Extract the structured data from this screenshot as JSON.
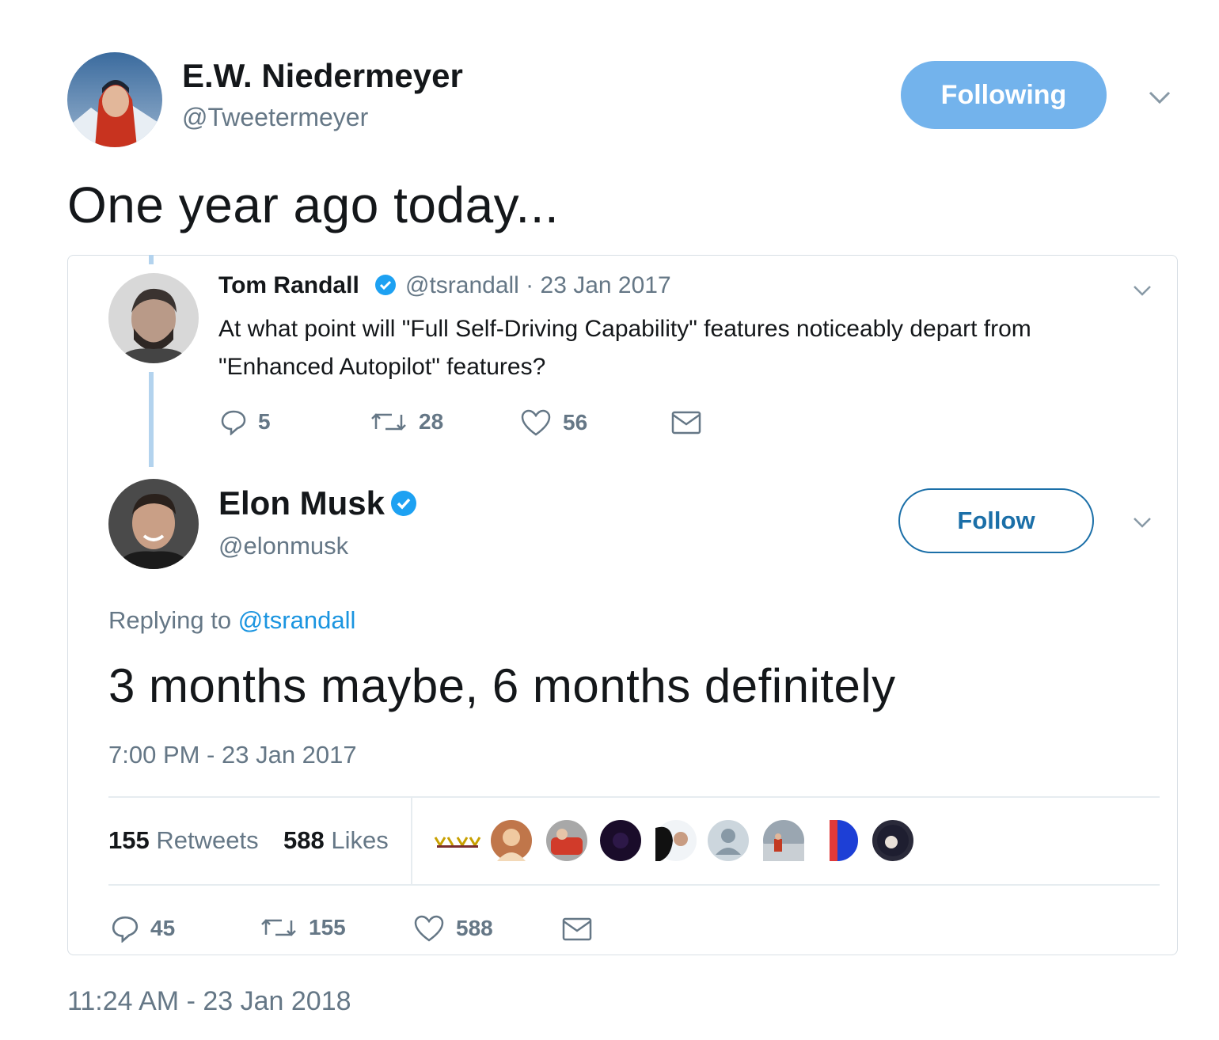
{
  "outer_tweet": {
    "author_name": "E.W. Niedermeyer",
    "author_handle": "@Tweetermeyer",
    "following_label": "Following",
    "text": "One year ago today...",
    "timestamp": "11:24 AM - 23 Jan 2018"
  },
  "quoted_thread": {
    "parent": {
      "author_name": "Tom Randall",
      "author_handle": "@tsrandall · 23 Jan 2017",
      "text": "At what point will \"Full Self-Driving Capability\" features noticeably depart from \"Enhanced Autopilot\" features?",
      "replies": "5",
      "retweets": "28",
      "likes": "56"
    },
    "reply": {
      "author_name": "Elon Musk",
      "author_handle": "@elonmusk",
      "follow_label": "Follow",
      "replying_prefix": "Replying to",
      "replying_handle": "@tsrandall",
      "text": "3 months maybe, 6 months definitely",
      "timestamp": "7:00 PM - 23 Jan 2017",
      "retweets_count": "155",
      "retweets_label": "Retweets",
      "likes_count": "588",
      "likes_label": "Likes",
      "replies": "45",
      "retweets": "155",
      "likes": "588"
    }
  },
  "colors": {
    "following_button": "#73b3ec",
    "follow_border": "#1b6fa8",
    "mention": "#1b95e0",
    "verified": "#1da1f2",
    "muted_text": "#657786",
    "thread_line": "#b3d3ee"
  }
}
